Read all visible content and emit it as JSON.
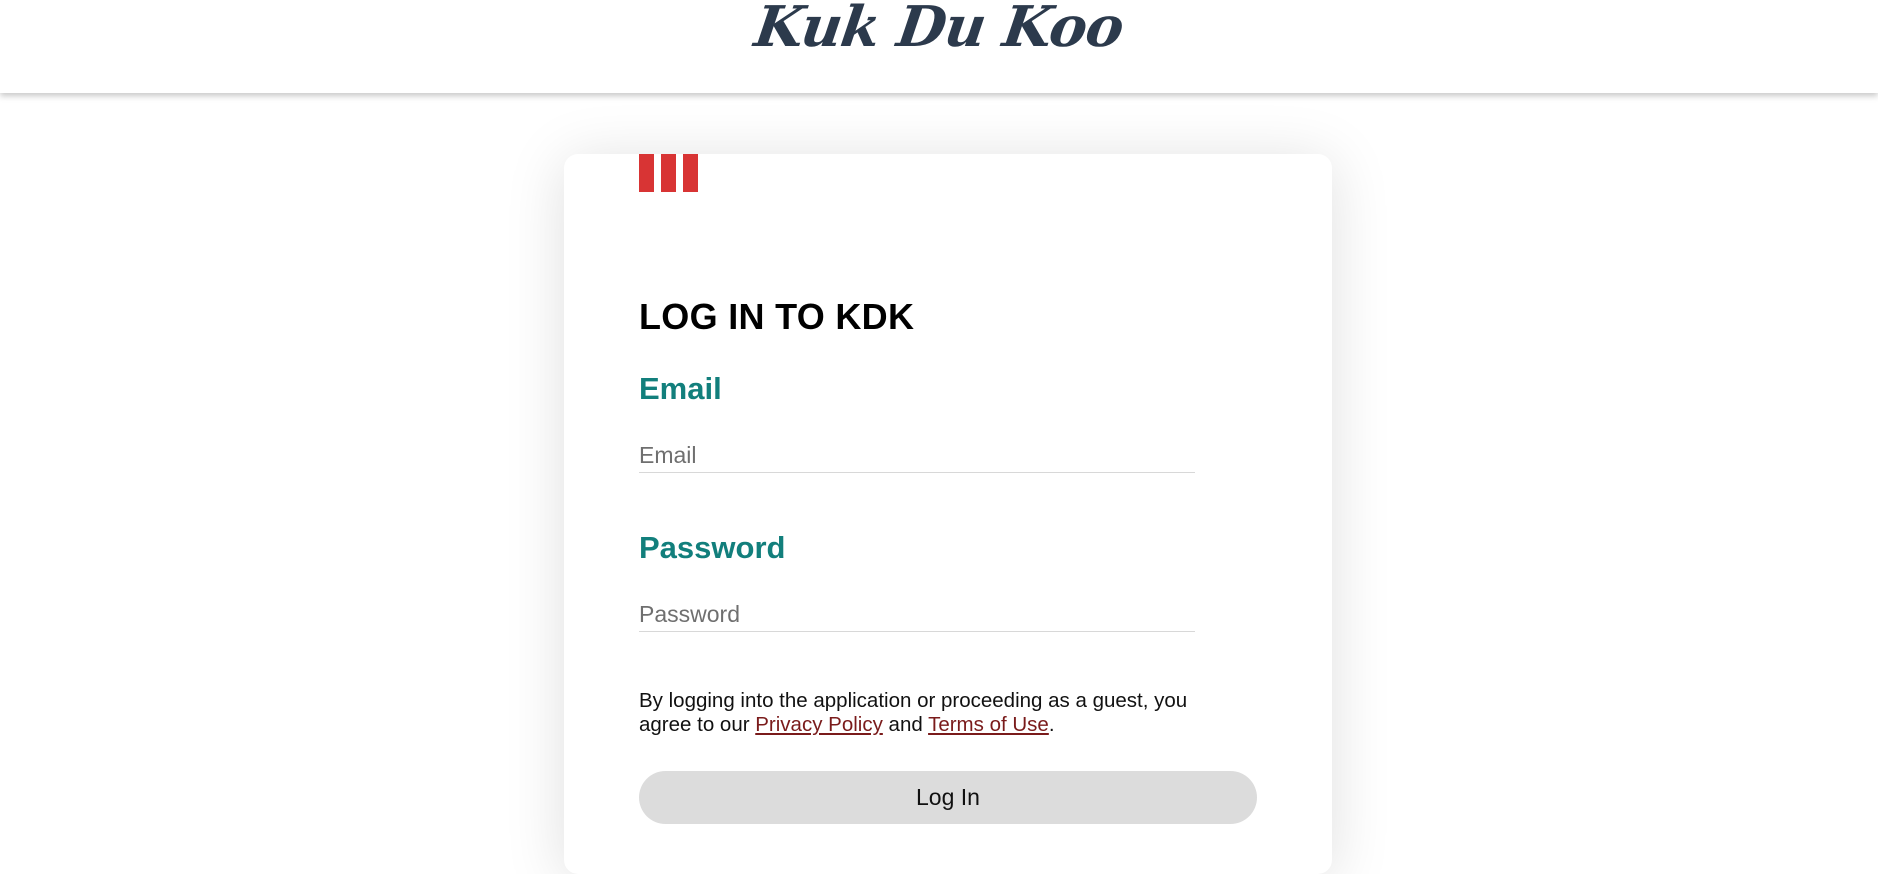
{
  "header": {
    "brand": "Kuk Du Koo"
  },
  "login": {
    "title": "LOG IN TO KDK",
    "email": {
      "label": "Email",
      "placeholder": "Email",
      "value": ""
    },
    "password": {
      "label": "Password",
      "placeholder": "Password",
      "value": ""
    },
    "consent": {
      "prefix": "By logging into the application or proceeding as a guest, you agree to our ",
      "privacy_link": "Privacy Policy",
      "middle": " and ",
      "terms_link": "Terms of Use",
      "suffix": "."
    },
    "submit_label": "Log In"
  },
  "colors": {
    "brand": "#2c3a4c",
    "accent_red": "#d83434",
    "label_teal": "#127f7c",
    "link_maroon": "#7a1b1b",
    "button_bg": "#dcdcdc"
  },
  "icons": {
    "logo": "three-red-bars-logo"
  }
}
